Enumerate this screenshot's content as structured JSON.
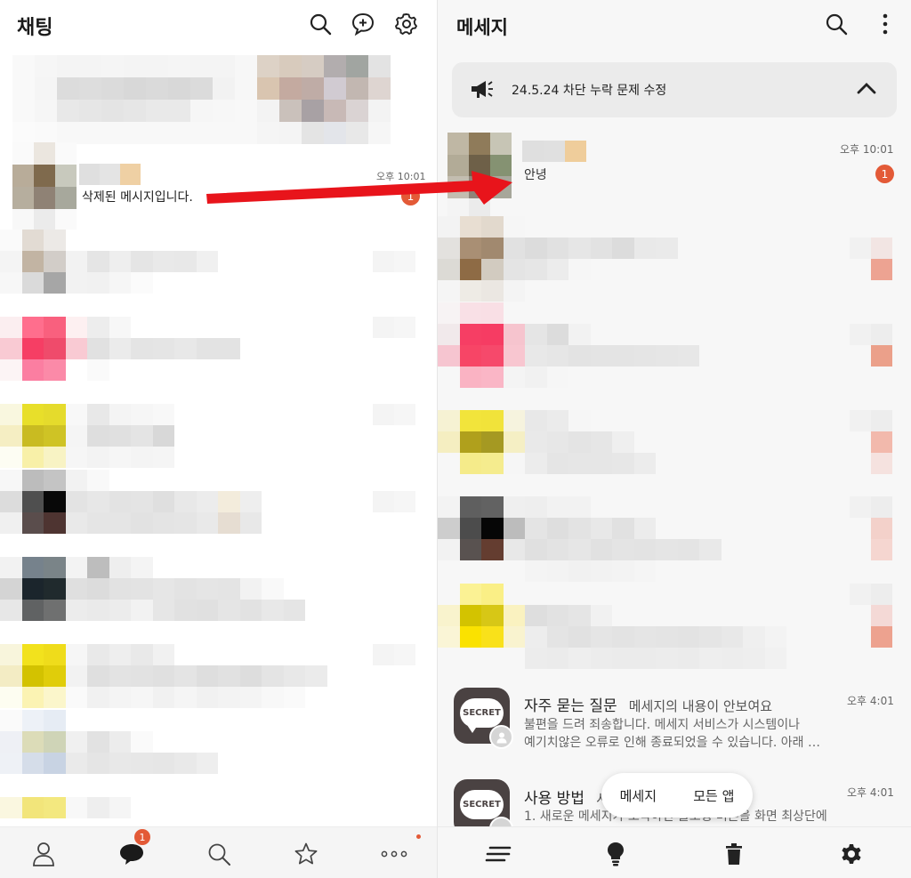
{
  "left": {
    "title": "채팅",
    "highlight_row": {
      "preview": "삭제된 메시지입니다.",
      "time": "오후 10:01",
      "badge": "1"
    },
    "tabbar": {
      "chat_badge": "1",
      "tabs": [
        "friends-icon",
        "chat-icon",
        "search-icon",
        "star-icon",
        "more-icon"
      ]
    }
  },
  "right": {
    "title": "메세지",
    "notice": {
      "text": "24.5.24 차단 누락 문제 수정"
    },
    "highlight_row": {
      "preview": "안녕",
      "time": "오후 10:01",
      "badge": "1"
    },
    "faq_items": [
      {
        "icon_label": "SECRET",
        "title": "자주 묻는 질문",
        "subtitle": "메세지의 내용이 안보여요",
        "time": "오후 4:01",
        "body_line1": "불편을 드려 죄송합니다. 메세지 서비스가 시스템이나",
        "body_line2": "예기치않은 오류로 인해 종료되었을 수 있습니다. 아래 …"
      },
      {
        "icon_label": "SECRET",
        "title": "사용 방법",
        "subtitle": "서",
        "time": "오후 4:01",
        "body_line1": "1. 새로운 메세지가 도착하면 플로팅 버튼을 화면 최상단에",
        "body_line2": ""
      }
    ],
    "toggle": {
      "option1": "메세지",
      "option2": "모든 앱"
    },
    "tabbar": [
      "list-icon",
      "bulb-icon",
      "trash-icon",
      "settings-icon"
    ]
  },
  "colors": {
    "accent": "#e35a37",
    "arrow": "#e8141b",
    "secret_icon": "#4a4242"
  }
}
